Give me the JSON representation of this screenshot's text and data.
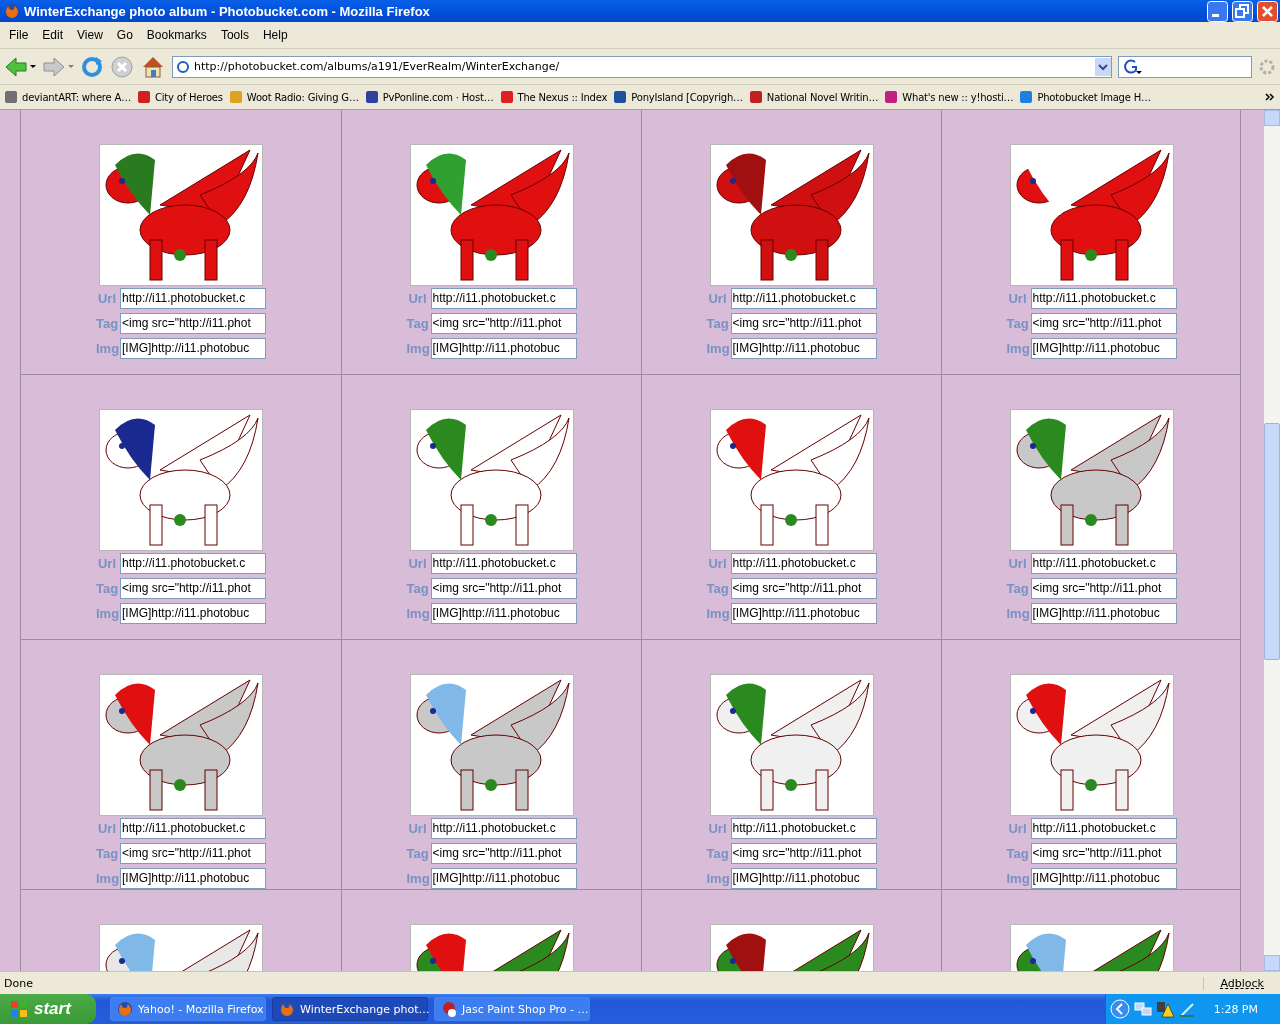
{
  "window": {
    "title": "WinterExchange photo album - Photobucket.com - Mozilla Firefox"
  },
  "menu": [
    "File",
    "Edit",
    "View",
    "Go",
    "Bookmarks",
    "Tools",
    "Help"
  ],
  "address": {
    "value": "http://photobucket.com/albums/a191/EverRealm/WinterExchange/"
  },
  "bookmarks": [
    "deviantART: where A…",
    "City of Heroes",
    "Woot Radio: Giving G…",
    "PvPonline.com · Host…",
    "The Nexus :: Index",
    "PonyIsland [Copyrigh…",
    "National Novel Writin…",
    "What's new :: y!hosti…",
    "Photobucket Image H…"
  ],
  "album": {
    "cells": [
      {
        "picture": {
          "kind": "picture"
        },
        "fields": [
          {
            "label": "Url",
            "value": "http://i11.photobucket.c"
          },
          {
            "label": "Tag",
            "value": "<img src=\"http://i11.phot"
          },
          {
            "label": "Img",
            "value": "[IMG]http://i11.photobuc"
          }
        ]
      },
      {
        "picture": {
          "kind": "picture"
        },
        "fields": [
          {
            "label": "Url",
            "value": "http://i11.photobucket.c"
          },
          {
            "label": "Tag",
            "value": "<img src=\"http://i11.phot"
          },
          {
            "label": "Img",
            "value": "[IMG]http://i11.photobuc"
          }
        ]
      },
      {
        "picture": {
          "kind": "picture"
        },
        "fields": [
          {
            "label": "Url",
            "value": "http://i11.photobucket.c"
          },
          {
            "label": "Tag",
            "value": "<img src=\"http://i11.phot"
          },
          {
            "label": "Img",
            "value": "[IMG]http://i11.photobuc"
          }
        ]
      },
      {
        "picture": {
          "kind": "picture"
        },
        "fields": [
          {
            "label": "Url",
            "value": "http://i11.photobucket.c"
          },
          {
            "label": "Tag",
            "value": "<img src=\"http://i11.phot"
          },
          {
            "label": "Img",
            "value": "[IMG]http://i11.photobuc"
          }
        ]
      },
      {
        "picture": {
          "kind": "picture"
        },
        "fields": [
          {
            "label": "Url",
            "value": "http://i11.photobucket.c"
          },
          {
            "label": "Tag",
            "value": "<img src=\"http://i11.phot"
          },
          {
            "label": "Img",
            "value": "[IMG]http://i11.photobuc"
          }
        ]
      },
      {
        "picture": {
          "kind": "picture"
        },
        "fields": [
          {
            "label": "Url",
            "value": "http://i11.photobucket.c"
          },
          {
            "label": "Tag",
            "value": "<img src=\"http://i11.phot"
          },
          {
            "label": "Img",
            "value": "[IMG]http://i11.photobuc"
          }
        ]
      },
      {
        "picture": {
          "kind": "picture"
        },
        "fields": [
          {
            "label": "Url",
            "value": "http://i11.photobucket.c"
          },
          {
            "label": "Tag",
            "value": "<img src=\"http://i11.phot"
          },
          {
            "label": "Img",
            "value": "[IMG]http://i11.photobuc"
          }
        ]
      },
      {
        "picture": {
          "kind": "picture"
        },
        "fields": [
          {
            "label": "Url",
            "value": "http://i11.photobucket.c"
          },
          {
            "label": "Tag",
            "value": "<img src=\"http://i11.phot"
          },
          {
            "label": "Img",
            "value": "[IMG]http://i11.photobuc"
          }
        ]
      },
      {
        "picture": {
          "kind": "picture"
        },
        "fields": [
          {
            "label": "Url",
            "value": "http://i11.photobucket.c"
          },
          {
            "label": "Tag",
            "value": "<img src=\"http://i11.phot"
          },
          {
            "label": "Img",
            "value": "[IMG]http://i11.photobuc"
          }
        ]
      },
      {
        "picture": {
          "kind": "picture"
        },
        "fields": [
          {
            "label": "Url",
            "value": "http://i11.photobucket.c"
          },
          {
            "label": "Tag",
            "value": "<img src=\"http://i11.phot"
          },
          {
            "label": "Img",
            "value": "[IMG]http://i11.photobuc"
          }
        ]
      },
      {
        "picture": {
          "kind": "picture"
        },
        "fields": [
          {
            "label": "Url",
            "value": "http://i11.photobucket.c"
          },
          {
            "label": "Tag",
            "value": "<img src=\"http://i11.phot"
          },
          {
            "label": "Img",
            "value": "[IMG]http://i11.photobuc"
          }
        ]
      },
      {
        "picture": {
          "kind": "picture"
        },
        "fields": [
          {
            "label": "Url",
            "value": "http://i11.photobucket.c"
          },
          {
            "label": "Tag",
            "value": "<img src=\"http://i11.phot"
          },
          {
            "label": "Img",
            "value": "[IMG]http://i11.photobuc"
          }
        ]
      },
      {
        "picture": {
          "kind": "picture"
        }
      },
      {
        "picture": {
          "kind": "picture"
        }
      },
      {
        "picture": {
          "kind": "picture"
        }
      },
      {
        "picture": {
          "kind": "picture"
        }
      }
    ]
  },
  "status_bar": {
    "text": "Done",
    "addon": "Adblock"
  },
  "taskbar": {
    "start": "start",
    "tasks": [
      {
        "label": "Yahoo! - Mozilla Firefox",
        "selected": false
      },
      {
        "label": "WinterExchange phot…",
        "selected": true
      },
      {
        "label": "Jasc Paint Shop Pro - …",
        "selected": false
      }
    ],
    "clock": "1:28 PM"
  }
}
